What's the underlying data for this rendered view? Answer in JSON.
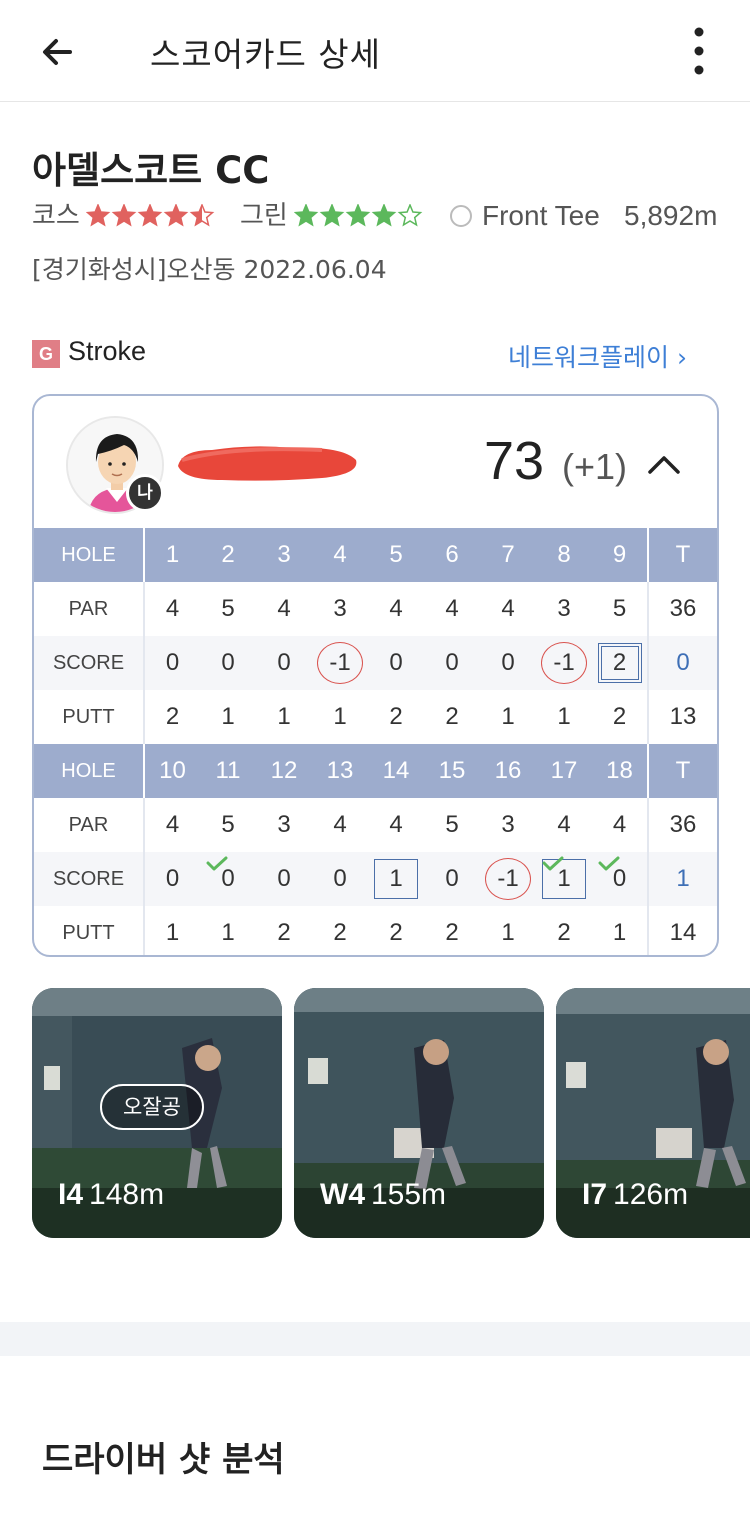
{
  "header": {
    "title": "스코어카드 상세",
    "back_icon": "arrow-left-icon",
    "more_icon": "more-vertical-icon"
  },
  "course": {
    "name": "아델스코트 CC",
    "course_label": "코스",
    "course_rating": 4.5,
    "green_label": "그린",
    "green_rating": 4,
    "tee": "Front Tee",
    "distance": "5,892m",
    "location_date": "[경기화성시]오산동 2022.06.04"
  },
  "mode": {
    "badge": "G",
    "name": "Stroke",
    "network_link": "네트워크플레이 ›"
  },
  "scorecard": {
    "me_badge": "나",
    "total": "73",
    "diff": "(+1)",
    "labels": {
      "hole": "HOLE",
      "par": "PAR",
      "score": "SCORE",
      "putt": "PUTT",
      "total": "T"
    },
    "front": {
      "holes": [
        "1",
        "2",
        "3",
        "4",
        "5",
        "6",
        "7",
        "8",
        "9"
      ],
      "par": [
        "4",
        "5",
        "4",
        "3",
        "4",
        "4",
        "4",
        "3",
        "5"
      ],
      "score": [
        "0",
        "0",
        "0",
        "-1",
        "0",
        "0",
        "0",
        "-1",
        "2"
      ],
      "putt": [
        "2",
        "1",
        "1",
        "1",
        "2",
        "2",
        "1",
        "1",
        "2"
      ],
      "par_total": "36",
      "score_total": "0",
      "putt_total": "13"
    },
    "back": {
      "holes": [
        "10",
        "11",
        "12",
        "13",
        "14",
        "15",
        "16",
        "17",
        "18"
      ],
      "par": [
        "4",
        "5",
        "3",
        "4",
        "4",
        "5",
        "3",
        "4",
        "4"
      ],
      "score": [
        "0",
        "0",
        "0",
        "0",
        "1",
        "0",
        "-1",
        "1",
        "0"
      ],
      "putt": [
        "1",
        "1",
        "2",
        "2",
        "2",
        "2",
        "1",
        "2",
        "1"
      ],
      "par_total": "36",
      "score_total": "1",
      "putt_total": "14"
    },
    "colors": {
      "header": "#9daccd",
      "birdie": "#d9534f",
      "bogey": "#4b6fa8",
      "check": "#5cb85c"
    }
  },
  "shots": [
    {
      "club": "I4",
      "distance": "148m",
      "tag": "오잘공"
    },
    {
      "club": "W4",
      "distance": "155m",
      "tag": ""
    },
    {
      "club": "I7",
      "distance": "126m",
      "tag": ""
    }
  ],
  "section": {
    "title": "드라이버 샷 분석"
  }
}
